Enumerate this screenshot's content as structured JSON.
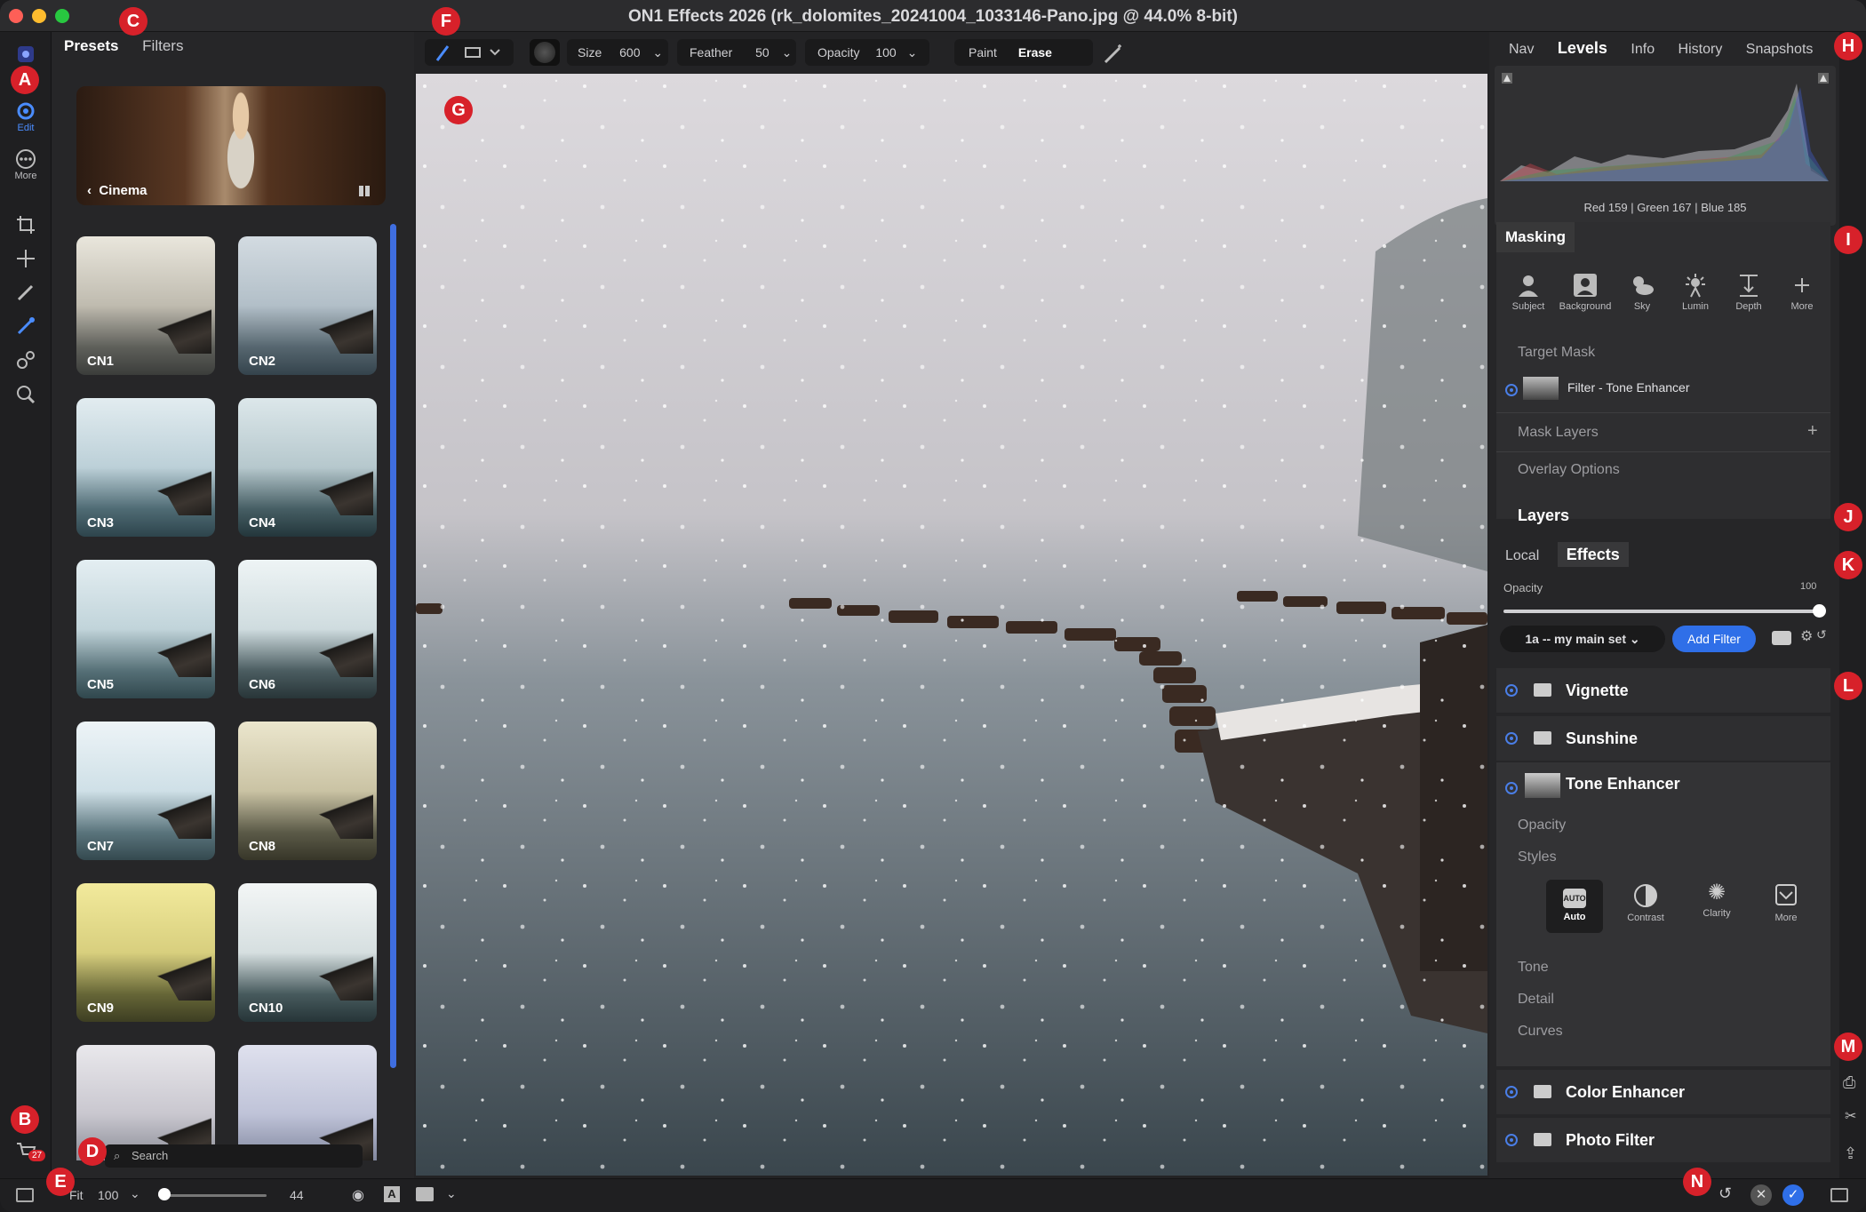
{
  "window": {
    "title": "ON1 Effects 2026 (rk_dolomites_20241004_1033146-Pano.jpg @ 44.0% 8-bit)"
  },
  "callouts": {
    "a": "A",
    "b": "B",
    "c": "C",
    "d": "D",
    "e": "E",
    "f": "F",
    "g": "G",
    "h": "H",
    "i": "I",
    "j": "J",
    "k": "K",
    "l": "L",
    "m": "M",
    "n": "N"
  },
  "left_rail": {
    "edit_label": "Edit",
    "more_label": "More",
    "cart_count": "27"
  },
  "presets_panel": {
    "tabs": [
      "Presets",
      "Filters"
    ],
    "category": "Cinema",
    "thumbnails": [
      "CN1",
      "CN2",
      "CN3",
      "CN4",
      "CN5",
      "CN6",
      "CN7",
      "CN8",
      "CN9",
      "CN10"
    ],
    "search_placeholder": "Search"
  },
  "toolbar": {
    "size_label": "Size",
    "size_value": "600",
    "feather_label": "Feather",
    "feather_value": "50",
    "opacity_label": "Opacity",
    "opacity_value": "100",
    "paint_label": "Paint",
    "erase_label": "Erase"
  },
  "right_tabs": [
    "Nav",
    "Levels",
    "Info",
    "History",
    "Snapshots"
  ],
  "levels": {
    "readout": "Red 159 | Green 167 | Blue 185"
  },
  "masking": {
    "title": "Masking",
    "tools": [
      "Subject",
      "Background",
      "Sky",
      "Lumin",
      "Depth",
      "More"
    ],
    "target_mask_label": "Target Mask",
    "target_layer": "Filter - Tone Enhancer",
    "mask_layers_label": "Mask Layers",
    "overlay_options_label": "Overlay Options"
  },
  "layers": {
    "title": "Layers",
    "tabs": [
      "Local",
      "Effects"
    ],
    "opacity_label": "Opacity",
    "opacity_value": "100",
    "preset_set": "1a -- my main set",
    "add_filter_label": "Add Filter",
    "filters": [
      "Vignette",
      "Sunshine",
      "Tone Enhancer",
      "Color Enhancer",
      "Photo Filter"
    ],
    "tone_enhancer": {
      "opacity_label": "Opacity",
      "styles_label": "Styles",
      "styles": [
        "Auto",
        "Contrast",
        "Clarity",
        "More"
      ],
      "sections": [
        "Tone",
        "Detail",
        "Curves"
      ]
    }
  },
  "bottom": {
    "fit_label": "Fit",
    "zoom_value": "100",
    "slider_value": "44"
  }
}
